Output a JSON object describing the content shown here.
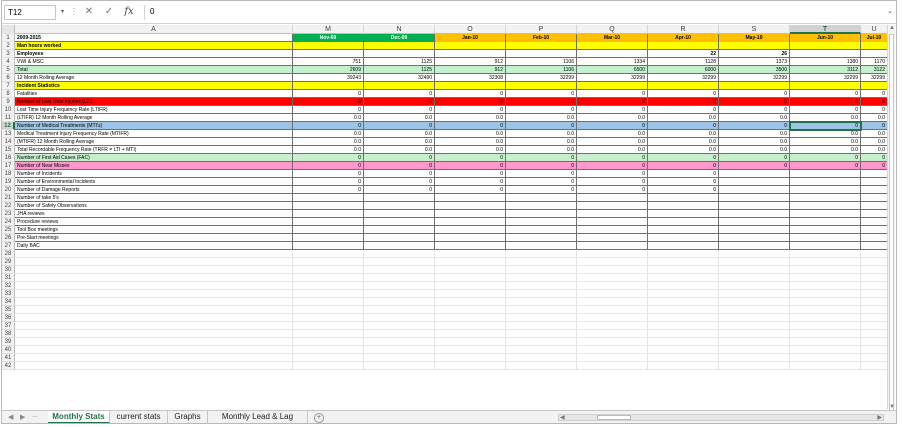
{
  "formula_bar": {
    "name_box": "T12",
    "name_box_arrow": "▾",
    "separator": "⋮",
    "cancel_icon": "✕",
    "enter_icon": "✓",
    "fx_label": "fx",
    "formula": "0",
    "expand_icon": "⌄"
  },
  "columns": [
    "A",
    "M",
    "N",
    "O",
    "P",
    "Q",
    "R",
    "S",
    "T",
    "U"
  ],
  "selected_column": "T",
  "selected_row": 12,
  "row_numbers": [
    "1",
    "2",
    "3",
    "4",
    "5",
    "6",
    "7",
    "8",
    "9",
    "10",
    "11",
    "12",
    "13",
    "14",
    "15",
    "16",
    "17",
    "18",
    "19",
    "20",
    "21",
    "22",
    "23",
    "24",
    "25",
    "26",
    "27",
    "28",
    "29",
    "30",
    "31",
    "32",
    "33",
    "34",
    "35",
    "36",
    "37",
    "38",
    "39",
    "40",
    "41",
    "42"
  ],
  "colors": {
    "yellow": "#ffff00",
    "green_header": "#00b050",
    "orange_header": "#ffc000",
    "light_green": "#c6efce",
    "red": "#ff0000",
    "blue": "#9dc3e6",
    "pink": "#ff99cc",
    "accent": "#217346"
  },
  "rows": [
    {
      "label": "2009-2015",
      "bold": true,
      "header": true,
      "values": [
        "Nov-09",
        "Dec-09",
        "Jan-10",
        "Feb-10",
        "Mar-10",
        "Apr-10",
        "May-10",
        "Jun-10",
        "Jul-10"
      ]
    },
    {
      "label": "Man hours worked",
      "bold": true,
      "fill": "yellow",
      "values": [
        "",
        "",
        "",
        "",
        "",
        "",
        "",
        "",
        ""
      ]
    },
    {
      "label": "Employees",
      "bold": true,
      "values": [
        "",
        "",
        "",
        "",
        "",
        "22",
        "26",
        "",
        ""
      ]
    },
    {
      "label": "VWI & MSC",
      "values": [
        "751",
        "1125",
        "912",
        "1106",
        "1334",
        "1128",
        "1373",
        "1380",
        "1170"
      ]
    },
    {
      "label": "Total",
      "fill": "light_green",
      "values": [
        "2609",
        "1125",
        "912",
        "1106",
        "6500",
        "6000",
        "3500",
        "3112",
        "3122"
      ]
    },
    {
      "label": "12 Month Rolling Average",
      "values": [
        "39243",
        "32490",
        "32308",
        "32299",
        "32299",
        "32299",
        "32299",
        "32299",
        "32299"
      ]
    },
    {
      "label": "Incident Statistics",
      "bold": true,
      "fill": "yellow",
      "values": [
        "",
        "",
        "",
        "",
        "",
        "",
        "",
        "",
        ""
      ]
    },
    {
      "label": "Fatalities",
      "values": [
        "0",
        "0",
        "0",
        "0",
        "0",
        "0",
        "0",
        "0",
        "0"
      ]
    },
    {
      "label": "Number of Lost Time Injuries (LTI)",
      "fill": "red",
      "values": [
        "0",
        "0",
        "0",
        "0",
        "0",
        "0",
        "0",
        "0",
        "0"
      ]
    },
    {
      "label": "Lost Time Injury Frequency Rate (LTIFR)",
      "values": [
        "0",
        "0",
        "0",
        "0",
        "0",
        "0",
        "0",
        "0",
        "0"
      ]
    },
    {
      "label": "(LTIFR) 12 Month Rolling Average",
      "values": [
        "0.0",
        "0.0",
        "0.0",
        "0.0",
        "0.0",
        "0.0",
        "0.0",
        "0.0",
        "0.0"
      ]
    },
    {
      "label": "Number of Medical Treatments (MTI's)",
      "fill": "blue",
      "values": [
        "0",
        "0",
        "0",
        "0",
        "0",
        "0",
        "0",
        "0",
        "0"
      ]
    },
    {
      "label": "Medical Treatment Injury Frequency Rate (MTIFR)",
      "values": [
        "0.0",
        "0.0",
        "0.0",
        "0.0",
        "0.0",
        "0.0",
        "0.0",
        "0.0",
        "0.0"
      ]
    },
    {
      "label": "(MTIFR) 12 Month Rolling Average",
      "values": [
        "0.0",
        "0.0",
        "0.0",
        "0.0",
        "0.0",
        "0.0",
        "0.0",
        "0.0",
        "0.0"
      ]
    },
    {
      "label": "Total Recordable Frequency Rate (TRFR = LTI + MTI)",
      "values": [
        "0.0",
        "0.0",
        "0.0",
        "0.0",
        "0.0",
        "0.0",
        "0.0",
        "0.0",
        "0.0"
      ]
    },
    {
      "label": "Number of First Aid Cases (FAC)",
      "fill": "light_green",
      "values": [
        "0",
        "0",
        "0",
        "0",
        "0",
        "0",
        "0",
        "0",
        "0"
      ]
    },
    {
      "label": "Number of Near Misses",
      "fill": "pink",
      "values": [
        "0",
        "0",
        "0",
        "0",
        "0",
        "0",
        "0",
        "0",
        "0"
      ]
    },
    {
      "label": "Number of Incidents",
      "values": [
        "0",
        "0",
        "0",
        "0",
        "0",
        "0",
        "",
        "",
        ""
      ]
    },
    {
      "label": "Number of Environmental Incidents",
      "values": [
        "0",
        "0",
        "0",
        "0",
        "0",
        "0",
        "",
        "",
        ""
      ]
    },
    {
      "label": "Number of Damage Reports",
      "values": [
        "0",
        "0",
        "0",
        "0",
        "0",
        "0",
        "",
        "",
        ""
      ]
    },
    {
      "label": "Number of take 5's",
      "values": [
        "",
        "",
        "",
        "",
        "",
        "",
        "",
        "",
        ""
      ]
    },
    {
      "label": "Number of Safety Observations",
      "values": [
        "",
        "",
        "",
        "",
        "",
        "",
        "",
        "",
        ""
      ]
    },
    {
      "label": "JHA reviews",
      "values": [
        "",
        "",
        "",
        "",
        "",
        "",
        "",
        "",
        ""
      ]
    },
    {
      "label": "Procedure reviews",
      "values": [
        "",
        "",
        "",
        "",
        "",
        "",
        "",
        "",
        ""
      ]
    },
    {
      "label": "Tool Box meetings",
      "values": [
        "",
        "",
        "",
        "",
        "",
        "",
        "",
        "",
        ""
      ]
    },
    {
      "label": "Pre-Start meetings",
      "values": [
        "",
        "",
        "",
        "",
        "",
        "",
        "",
        "",
        ""
      ]
    },
    {
      "label": "Daily BAC",
      "values": [
        "",
        "",
        "",
        "",
        "",
        "",
        "",
        "",
        ""
      ]
    }
  ],
  "sheet_tabs": {
    "nav_prev": "◀",
    "nav_next": "▶",
    "more": "...",
    "add_icon": "+",
    "tabs": [
      "Monthly Stats",
      "current stats",
      "Graphs",
      "Monthly  Lead & Lag"
    ],
    "active": 0
  },
  "scroll": {
    "up": "▲",
    "down": "▼",
    "left": "◀",
    "right": "▶"
  }
}
